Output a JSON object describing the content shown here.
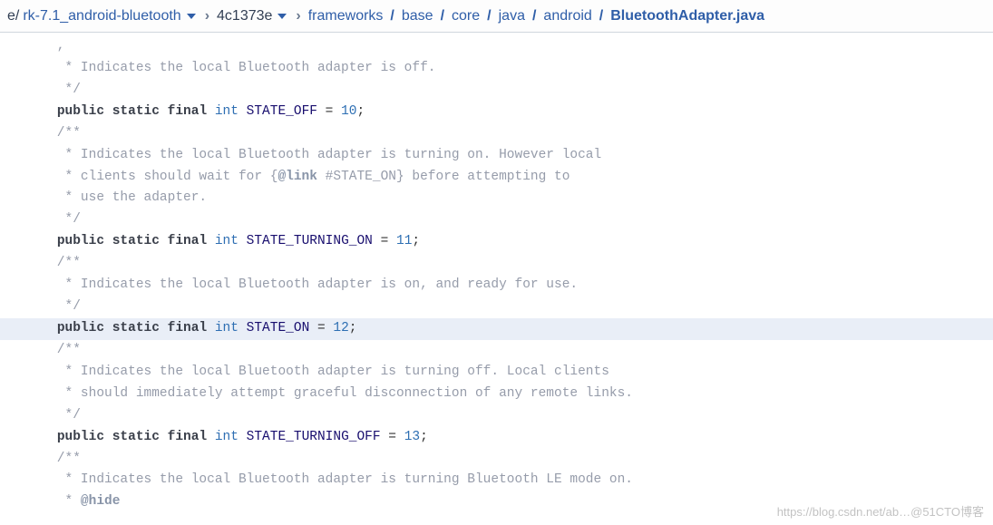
{
  "breadcrumb": {
    "branch_prefix": "e/",
    "branch": "rk-7.1_android-bluetooth",
    "commit": "4c1373e",
    "path": [
      "frameworks",
      "base",
      "core",
      "java",
      "android"
    ],
    "file": "BluetoothAdapter.java"
  },
  "code": {
    "l0": "    ,",
    "l1": "     * Indicates the local Bluetooth adapter is off.",
    "l2": "     */",
    "l3a": "    ",
    "l3_kw": "public static final",
    "l3_sp": " ",
    "l3_type": "int",
    "l3_sp2": " ",
    "l3_name": "STATE_OFF",
    "l3_eq": " = ",
    "l3_val": "10",
    "l3_semi": ";",
    "l4": "    /**",
    "l5": "     * Indicates the local Bluetooth adapter is turning on. However local",
    "l6a": "     * clients should wait for {",
    "l6_link": "@link",
    "l6b": " #STATE_ON} before attempting to",
    "l7": "     * use the adapter.",
    "l8": "     */",
    "l9a": "    ",
    "l9_kw": "public static final",
    "l9_sp": " ",
    "l9_type": "int",
    "l9_sp2": " ",
    "l9_name": "STATE_TURNING_ON",
    "l9_eq": " = ",
    "l9_val": "11",
    "l9_semi": ";",
    "l10": "    /**",
    "l11": "     * Indicates the local Bluetooth adapter is on, and ready for use.",
    "l12": "     */",
    "l13a": "    ",
    "l13_kw": "public static final",
    "l13_sp": " ",
    "l13_type": "int",
    "l13_sp2": " ",
    "l13_name": "STATE_ON",
    "l13_eq": " = ",
    "l13_val": "12",
    "l13_semi": ";",
    "l14": "    /**",
    "l15": "     * Indicates the local Bluetooth adapter is turning off. Local clients",
    "l16": "     * should immediately attempt graceful disconnection of any remote links.",
    "l17": "     */",
    "l18a": "    ",
    "l18_kw": "public static final",
    "l18_sp": " ",
    "l18_type": "int",
    "l18_sp2": " ",
    "l18_name": "STATE_TURNING_OFF",
    "l18_eq": " = ",
    "l18_val": "13",
    "l18_semi": ";",
    "l19": "",
    "l20": "    /**",
    "l21": "     * Indicates the local Bluetooth adapter is turning Bluetooth LE mode on.",
    "l22a": "     * ",
    "l22_tag": "@hide"
  },
  "watermark": "https://blog.csdn.net/ab…@51CTO博客"
}
